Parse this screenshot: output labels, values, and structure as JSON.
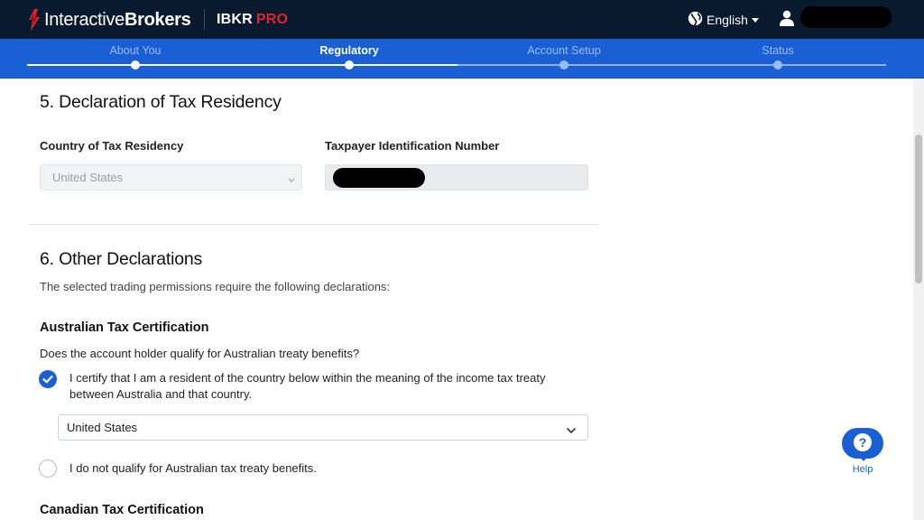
{
  "header": {
    "logo_text_regular": "Interactive",
    "logo_text_bold": "Brokers",
    "product_name": "IBKR",
    "product_tier": "PRO",
    "language": "English"
  },
  "stepper": {
    "steps": [
      {
        "label": "About You",
        "state": "done"
      },
      {
        "label": "Regulatory",
        "state": "active"
      },
      {
        "label": "Account Setup",
        "state": "pending"
      },
      {
        "label": "Status",
        "state": "pending"
      }
    ]
  },
  "tax_residency": {
    "heading": "5. Declaration of Tax Residency",
    "country_label": "Country of Tax Residency",
    "country_value": "United States",
    "tin_label": "Taxpayer Identification Number"
  },
  "other_declarations": {
    "heading": "6. Other Declarations",
    "description": "The selected trading permissions require the following declarations:",
    "australian": {
      "heading": "Australian Tax Certification",
      "question": "Does the account holder qualify for Australian treaty benefits?",
      "option_certify_line1": "I certify that I am a resident of the country below within the meaning of the income tax treaty",
      "option_certify_line2": "between Australia and that country.",
      "option_certify_checked": true,
      "treaty_country": "United States",
      "option_not_qualify": "I do not qualify for Australian tax treaty benefits.",
      "option_not_qualify_checked": false
    },
    "canadian_heading": "Canadian Tax Certification"
  },
  "help": {
    "label": "Help"
  },
  "colors": {
    "header_bg": "#0a1a2e",
    "stepper_bg": "#1a5fd4",
    "brand_red": "#e2232a",
    "accent_blue": "#1a5fd4"
  }
}
